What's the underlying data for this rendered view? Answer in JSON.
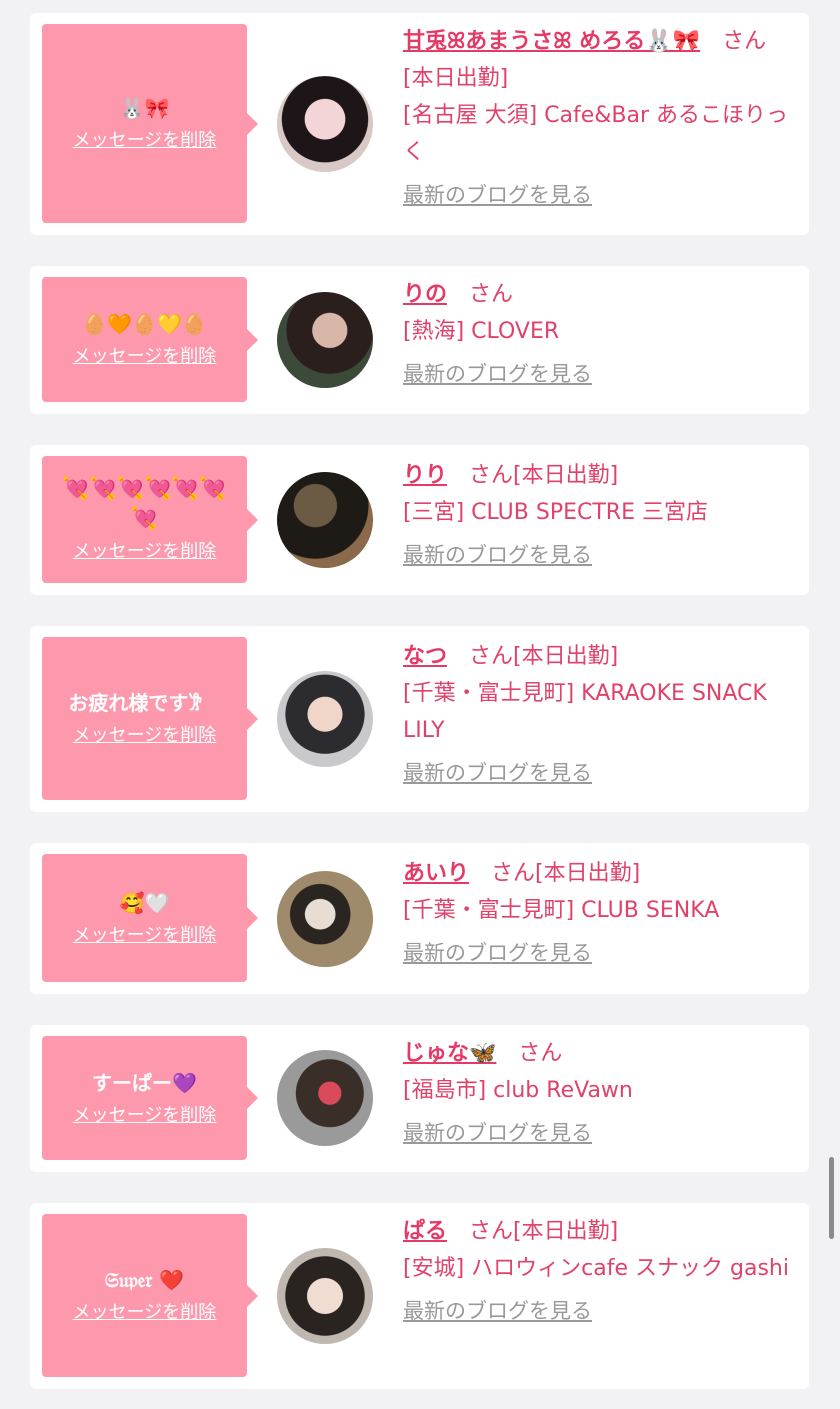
{
  "delete_label": "メッセージを削除",
  "san": "さん",
  "blog_link": "最新のブログを見る",
  "colors": {
    "bubble": "#fd98ad",
    "name": "#e63a66",
    "text": "#e0426a",
    "link_gray": "#999999"
  },
  "cards": [
    {
      "message": "🐰🎀",
      "name": "甘兎ꕤあまうさꕤ めろる🐰🎀",
      "san": "さん",
      "status": "[本日出勤]",
      "shop": "[名古屋 大須] Cafe&Bar あるこほりっく"
    },
    {
      "message": "🥚🧡🥚💛🥚",
      "name": "りの",
      "san": "さん",
      "status": "",
      "shop": "[熱海] CLOVER"
    },
    {
      "message": "💘💘💘💘💘💘💘",
      "name": "りり",
      "san": "さん",
      "status": "[本日出勤]",
      "shop": "[三宮] CLUB SPECTRE 三宮店"
    },
    {
      "message": "お疲れ様です𐦂ㅤ",
      "name": "なつ",
      "san": "さん",
      "status": "[本日出勤]",
      "shop": "[千葉・富士見町] KARAOKE SNACK LILY"
    },
    {
      "message": "🥰🤍",
      "name": "あいり",
      "san": "さん",
      "status": "[本日出勤]",
      "shop": "[千葉・富士見町] CLUB SENKA"
    },
    {
      "message": "すーぱー💜",
      "name": "じゅな🦋",
      "san": "さん",
      "status": "",
      "shop": "[福島市] club ReVawn"
    },
    {
      "message": "𝔖𝔲𝔭𝔢𝔯 ❤️",
      "name": "ぱる",
      "san": "さん",
      "status": "[本日出勤]",
      "shop": "[安城] ハロウィンcafe スナック gashi"
    }
  ]
}
